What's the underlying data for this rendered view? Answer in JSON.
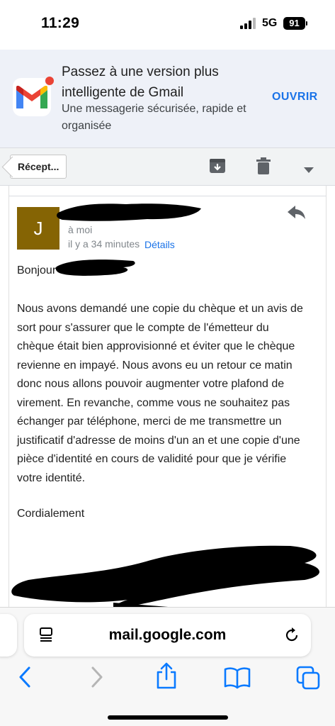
{
  "status_bar": {
    "time": "11:29",
    "network": "5G",
    "battery": "91"
  },
  "banner": {
    "title": "Passez à une version plus intelligente de Gmail",
    "subtitle": "Une messagerie sécurisée, rapide et organisée",
    "open_label": "OUVRIR"
  },
  "toolbar": {
    "back_label": "Récept...",
    "icons": [
      "archive-icon",
      "trash-icon",
      "more-dropdown-icon"
    ]
  },
  "email": {
    "avatar_letter": "J",
    "to": "à moi",
    "time": "il y a 34 minutes",
    "details_label": "Détails",
    "greeting": "Bonjour",
    "body": "Nous avons demandé une copie du chèque et un avis de sort pour s'assurer que le compte de l'émetteur du chèque était bien approvisionné et éviter que le chèque revienne en impayé. Nous avons eu un retour ce matin donc nous allons pouvoir augmenter votre plafond de virement. En revanche, comme vous ne souhaitez pas échanger par téléphone, merci de me transmettre un justificatif d'adresse de moins d'un an et une copie d'une pièce d'identité en cours de validité pour que je vérifie votre identité.",
    "signoff": "Cordialement",
    "avatar_color": "#856404",
    "link_color": "#1a73e8"
  },
  "browser": {
    "url": "mail.google.com",
    "nav_icons": [
      "back-icon",
      "forward-icon",
      "share-icon",
      "bookmarks-icon",
      "tabs-icon"
    ],
    "accent": "#0a7aff"
  }
}
